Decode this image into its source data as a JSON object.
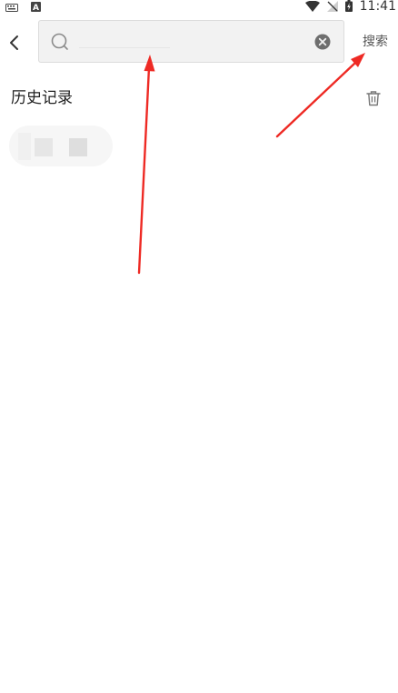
{
  "status_bar": {
    "time": "11:41",
    "left_icons": [
      "keyboard-icon",
      "a-notification-icon"
    ],
    "right_icons": [
      "wifi-icon",
      "no-signal-icon",
      "battery-charging-icon"
    ]
  },
  "header": {
    "back_icon": "chevron-left-icon",
    "search": {
      "value": "",
      "placeholder": "",
      "clear_icon": "clear-circle-icon"
    },
    "search_button_label": "搜索"
  },
  "history": {
    "title": "历史记录",
    "delete_icon": "trash-icon",
    "items": [
      {
        "label": ""
      }
    ]
  },
  "colors": {
    "arrow": "#ee2a24",
    "background": "#ffffff",
    "search_bg": "#f2f2f2"
  }
}
